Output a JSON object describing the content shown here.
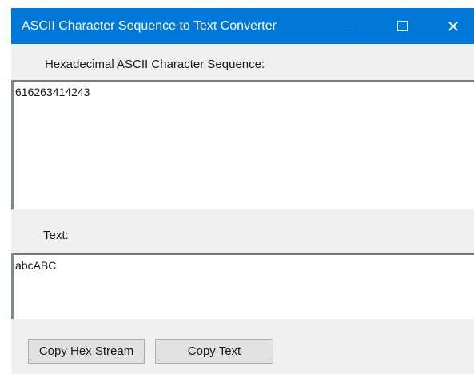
{
  "window": {
    "title": "ASCII Character Sequence to Text Converter",
    "controls": {
      "minimize": "minimize-icon",
      "maximize": "maximize-icon",
      "close": "close-icon"
    },
    "colors": {
      "titlebar": "#0078d7",
      "background": "#f0f0f0"
    }
  },
  "hex_section": {
    "label": "Hexadecimal ASCII Character Sequence:",
    "value": "616263414243"
  },
  "text_section": {
    "label": "Text:",
    "value": "abcABC"
  },
  "buttons": {
    "copy_hex": "Copy Hex Stream",
    "copy_text": "Copy Text"
  }
}
